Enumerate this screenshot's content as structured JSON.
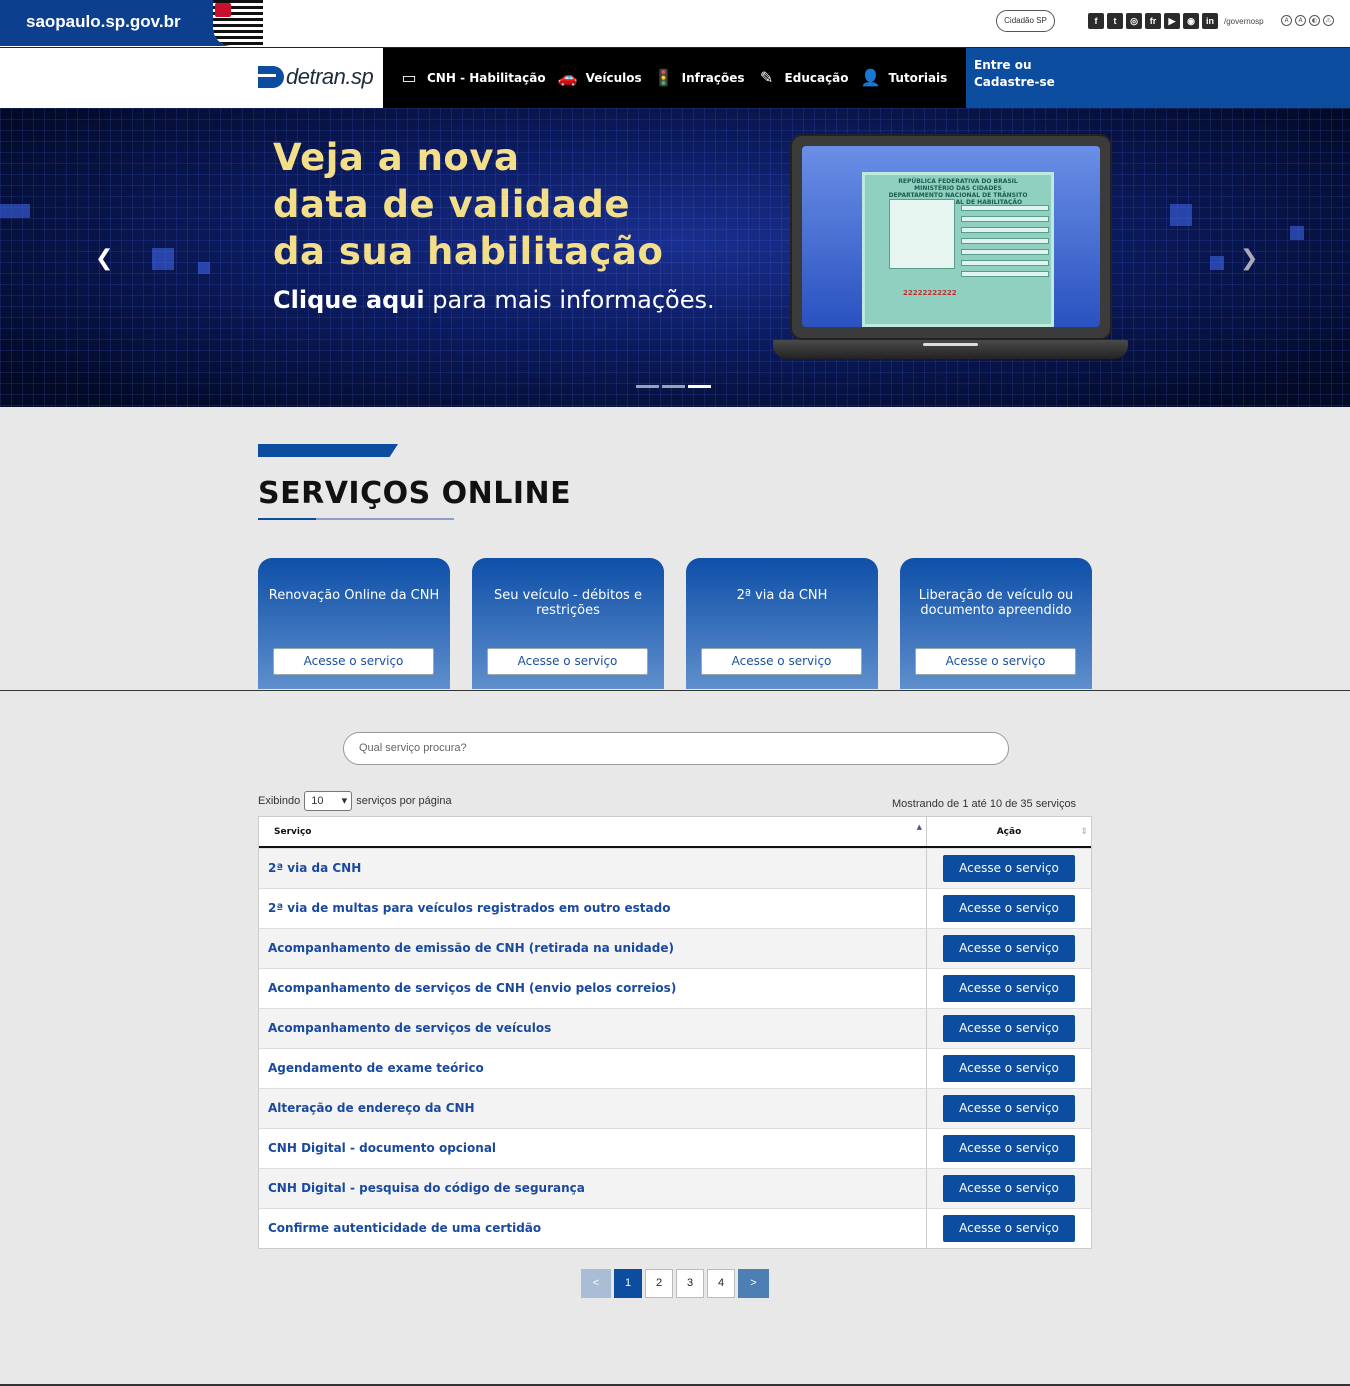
{
  "gov": {
    "site": "saopaulo.sp.gov.br",
    "cidadao": "Cidadão SP",
    "socials": [
      "f",
      "t",
      "◎",
      "fr",
      "▶",
      "◉",
      "in"
    ],
    "handle": "/governosp",
    "a11y": [
      "A",
      "A",
      "◐",
      "⚠"
    ]
  },
  "nav": {
    "logo": "detran.sp",
    "items": [
      {
        "label": "CNH - Habilitação",
        "icon": "▭"
      },
      {
        "label": "Veículos",
        "icon": "🚗"
      },
      {
        "label": "Infrações",
        "icon": "🚦"
      },
      {
        "label": "Educação",
        "icon": "✎"
      },
      {
        "label": "Tutoriais",
        "icon": "👤"
      }
    ],
    "login_line1": "Entre ou",
    "login_line2": "Cadastre-se"
  },
  "banner": {
    "line1": "Veja a nova",
    "line2": "data de validade",
    "line3": "da sua habilitação",
    "cta_bold": "Clique aqui",
    "cta_rest": " para mais informações.",
    "card_header1": "REPÚBLICA FEDERATIVA DO BRASIL",
    "card_header2": "MINISTÉRIO DAS CIDADES",
    "card_header3": "DEPARTAMENTO NACIONAL DE TRÂNSITO",
    "card_header4": "CARTEIRA NACIONAL DE HABILITAÇÃO",
    "card_number": "22222222222",
    "active_slide": 3,
    "slide_count": 3
  },
  "services": {
    "title": "SERVIÇOS ONLINE",
    "cards": [
      {
        "title": "Renovação Online da CNH",
        "button": "Acesse o serviço"
      },
      {
        "title": "Seu veículo - débitos e restrições",
        "button": "Acesse o serviço"
      },
      {
        "title": "2ª via da CNH",
        "button": "Acesse o serviço"
      },
      {
        "title": "Liberação de veículo ou documento apreendido",
        "button": "Acesse o serviço"
      }
    ]
  },
  "search": {
    "placeholder": "Qual serviço procura?"
  },
  "table": {
    "show_prefix": "Exibindo",
    "page_size": "10",
    "show_suffix": "serviços por página",
    "info": "Mostrando de 1 até 10 de 35 serviços",
    "col_service": "Serviço",
    "col_action": "Ação",
    "rows": [
      {
        "service": "2ª via da CNH",
        "action": "Acesse o serviço"
      },
      {
        "service": "2ª via de multas para veículos registrados em outro estado",
        "action": "Acesse o serviço"
      },
      {
        "service": "Acompanhamento de emissão de CNH (retirada na unidade)",
        "action": "Acesse o serviço"
      },
      {
        "service": "Acompanhamento de serviços de CNH (envio pelos correios)",
        "action": "Acesse o serviço"
      },
      {
        "service": "Acompanhamento de serviços de veículos",
        "action": "Acesse o serviço"
      },
      {
        "service": "Agendamento de exame teórico",
        "action": "Acesse o serviço"
      },
      {
        "service": "Alteração de endereço da CNH",
        "action": "Acesse o serviço"
      },
      {
        "service": "CNH Digital - documento opcional",
        "action": "Acesse o serviço"
      },
      {
        "service": "CNH Digital - pesquisa do código de segurança",
        "action": "Acesse o serviço"
      },
      {
        "service": "Confirme autenticidade de uma certidão",
        "action": "Acesse o serviço"
      }
    ]
  },
  "pager": {
    "prev": "<",
    "pages": [
      "1",
      "2",
      "3",
      "4"
    ],
    "current": "1",
    "next": ">"
  },
  "colors": {
    "brand_blue": "#0d4da0",
    "banner_yellow": "#f3df8a"
  }
}
